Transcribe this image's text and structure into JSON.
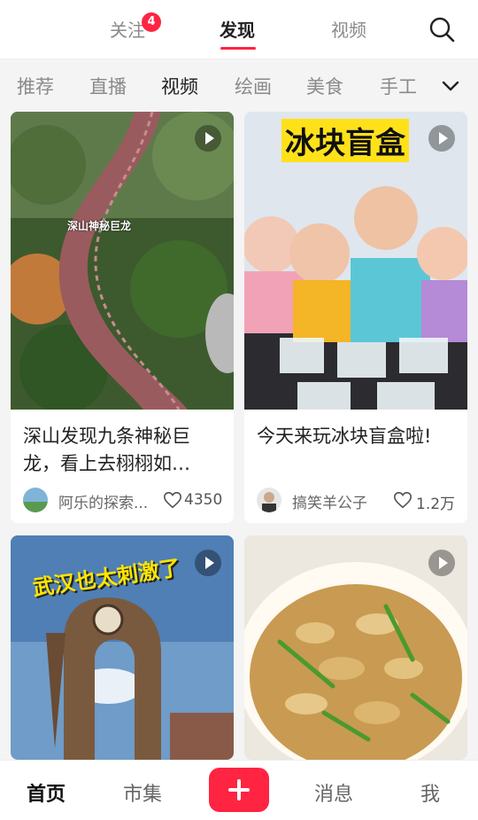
{
  "top_tabs": [
    {
      "label": "关注",
      "badge": "4"
    },
    {
      "label": "发现",
      "active": true
    },
    {
      "label": "视频"
    }
  ],
  "categories": [
    "推荐",
    "直播",
    "视频",
    "绘画",
    "美食",
    "手工"
  ],
  "active_category": "视频",
  "cards": [
    {
      "overlay": "深山神秘巨龙",
      "title": "深山发现九条神秘巨龙，看上去栩栩如…",
      "author": "阿乐的探索...",
      "likes": "4350"
    },
    {
      "overlay": "冰块盲盒",
      "title": "今天来玩冰块盲盒啦!",
      "author": "搞笑羊公子",
      "likes": "1.2万"
    },
    {
      "overlay": "武汉也太刺激了"
    },
    {}
  ],
  "bottom_nav": [
    "首页",
    "市集",
    "消息",
    "我"
  ],
  "colors": {
    "accent": "#ff2442"
  }
}
